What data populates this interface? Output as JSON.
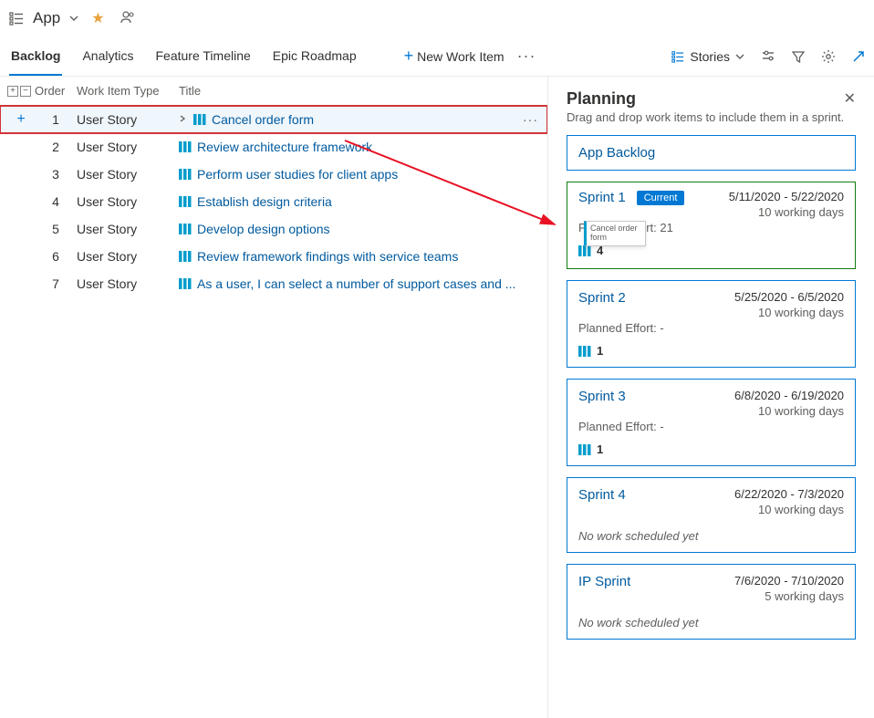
{
  "header": {
    "app_title": "App"
  },
  "tabs": {
    "items": [
      "Backlog",
      "Analytics",
      "Feature Timeline",
      "Epic Roadmap"
    ],
    "new_item_label": "New Work Item",
    "view_label": "Stories"
  },
  "grid": {
    "columns": {
      "order": "Order",
      "type": "Work Item Type",
      "title": "Title"
    },
    "rows": [
      {
        "order": "1",
        "type": "User Story",
        "title": "Cancel order form"
      },
      {
        "order": "2",
        "type": "User Story",
        "title": "Review architecture framework"
      },
      {
        "order": "3",
        "type": "User Story",
        "title": "Perform user studies for client apps"
      },
      {
        "order": "4",
        "type": "User Story",
        "title": "Establish design criteria"
      },
      {
        "order": "5",
        "type": "User Story",
        "title": "Develop design options"
      },
      {
        "order": "6",
        "type": "User Story",
        "title": "Review framework findings with service teams"
      },
      {
        "order": "7",
        "type": "User Story",
        "title": "As a user, I can select a number of support cases and ..."
      }
    ]
  },
  "panel": {
    "title": "Planning",
    "subtitle": "Drag and drop work items to include them in a sprint.",
    "backlog_bucket": "App Backlog",
    "drag_ghost": "Cancel order form",
    "planned_effort_label": "Planned Effort:",
    "no_work_text": "No work scheduled yet",
    "current_label": "Current",
    "sprints": [
      {
        "name": "Sprint 1",
        "effort": "21",
        "dates": "5/11/2020 - 5/22/2020",
        "days": "10 working days",
        "count": "4",
        "current": true
      },
      {
        "name": "Sprint 2",
        "effort": "-",
        "dates": "5/25/2020 - 6/5/2020",
        "days": "10 working days",
        "count": "1",
        "current": false
      },
      {
        "name": "Sprint 3",
        "effort": "-",
        "dates": "6/8/2020 - 6/19/2020",
        "days": "10 working days",
        "count": "1",
        "current": false
      },
      {
        "name": "Sprint 4",
        "effort": null,
        "dates": "6/22/2020 - 7/3/2020",
        "days": "10 working days",
        "count": null,
        "current": false
      },
      {
        "name": "IP Sprint",
        "effort": null,
        "dates": "7/6/2020 - 7/10/2020",
        "days": "5 working days",
        "count": null,
        "current": false
      }
    ]
  }
}
